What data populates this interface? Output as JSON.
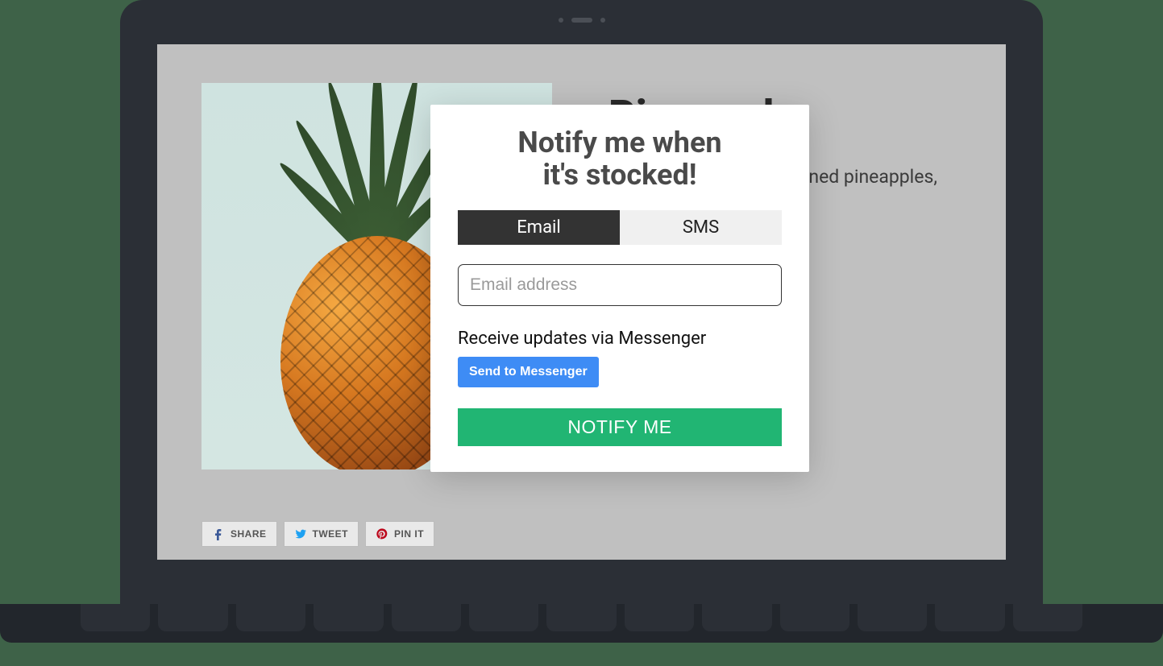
{
  "product": {
    "title": "Pineapple",
    "description": "e dopest fruit on the canned pineapples, llow you to enjoy the"
  },
  "share": {
    "facebook": "SHARE",
    "twitter": "TWEET",
    "pinterest": "PIN IT"
  },
  "modal": {
    "title_line1": "Notify me when",
    "title_line2": "it's stocked!",
    "tabs": {
      "email": "Email",
      "sms": "SMS"
    },
    "email_placeholder": "Email address",
    "messenger_label": "Receive updates via Messenger",
    "messenger_button": "Send to Messenger",
    "notify_button": "NOTIFY ME"
  }
}
